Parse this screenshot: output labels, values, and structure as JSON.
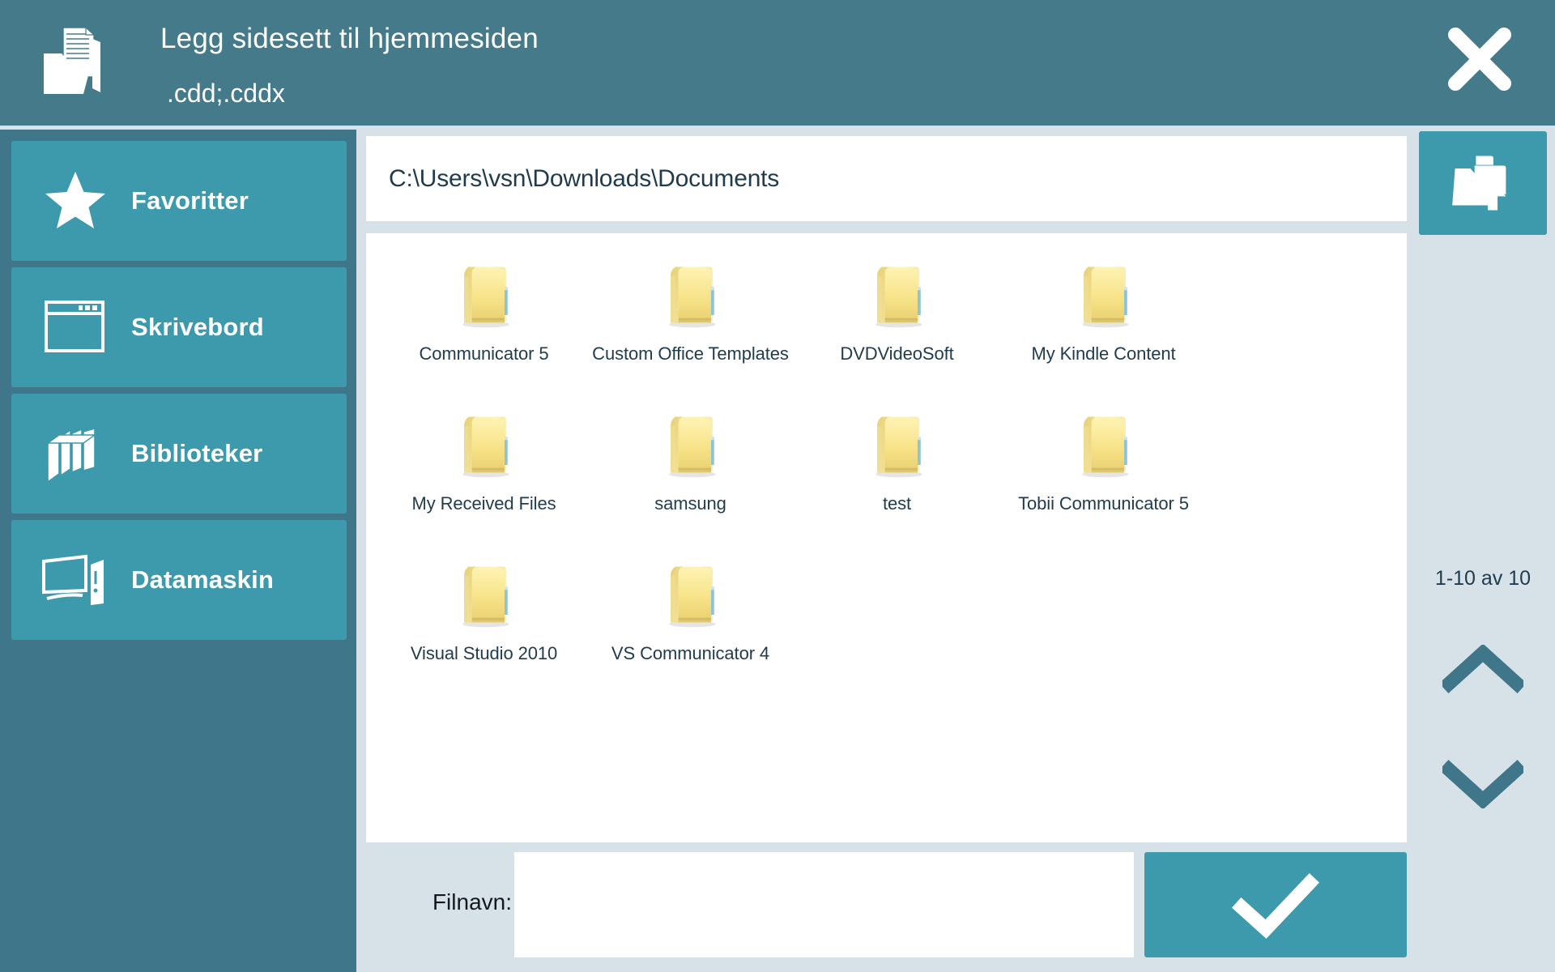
{
  "header": {
    "title": "Legg sidesett til hjemmesiden",
    "subtitle": ".cdd;.cddx",
    "icon": "open-folder-documents-icon",
    "close_icon": "close-icon",
    "bg_color": "#457a8b"
  },
  "sidebar": {
    "bg_color": "#3f7689",
    "tile_color": "#3d9aad",
    "items": [
      {
        "label": "Favoritter",
        "icon": "star-icon"
      },
      {
        "label": "Skrivebord",
        "icon": "window-icon"
      },
      {
        "label": "Biblioteker",
        "icon": "books-icon"
      },
      {
        "label": "Datamaskin",
        "icon": "computer-icon"
      }
    ]
  },
  "path_bar": {
    "path": "C:\\Users\\vsn\\Downloads\\Documents"
  },
  "files": {
    "items": [
      {
        "name": "Communicator 5",
        "type": "folder"
      },
      {
        "name": "Custom Office Templates",
        "type": "folder"
      },
      {
        "name": "DVDVideoSoft",
        "type": "folder"
      },
      {
        "name": "My Kindle Content",
        "type": "folder"
      },
      {
        "name": "My Received Files",
        "type": "folder"
      },
      {
        "name": "samsung",
        "type": "folder"
      },
      {
        "name": "test",
        "type": "folder"
      },
      {
        "name": "Tobii Communicator 5",
        "type": "folder"
      },
      {
        "name": "Visual Studio 2010",
        "type": "folder"
      },
      {
        "name": "VS Communicator 4",
        "type": "folder"
      }
    ]
  },
  "right_rail": {
    "up_button_icon": "folder-up-icon",
    "page_count": "1-10 av 10",
    "scroll_up_icon": "chevron-up-icon",
    "scroll_down_icon": "chevron-down-icon",
    "arrow_color": "#3f7689"
  },
  "bottom": {
    "filename_label": "Filnavn:",
    "filename_value": "",
    "filename_placeholder": "",
    "confirm_icon": "checkmark-icon",
    "confirm_color": "#3d9aad"
  }
}
